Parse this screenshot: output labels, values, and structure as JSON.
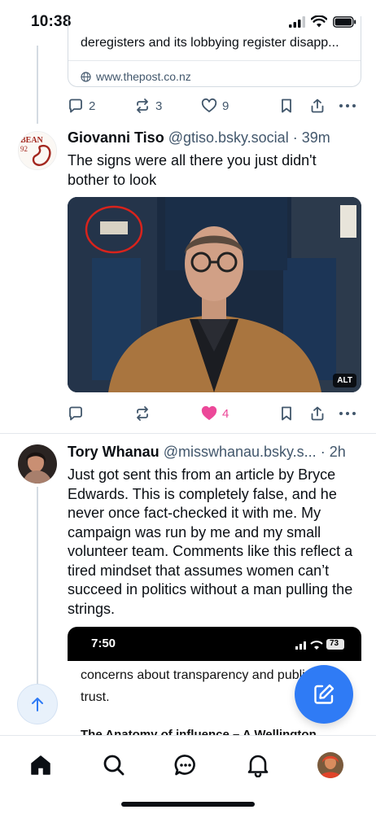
{
  "status_bar": {
    "time": "10:38"
  },
  "top_post": {
    "link_description": "deregisters and its lobbying register disapp...",
    "link_domain": "www.thepost.co.nz",
    "replies": "2",
    "reposts": "3",
    "likes": "9"
  },
  "post_giovanni": {
    "avatar_text": "BEAN 92",
    "name": "Giovanni Tiso",
    "handle": "@gtiso.bsky.social",
    "age": "39m",
    "text": "The signs were all there you just didn't bother to look",
    "image_alt_badge": "ALT",
    "likes": "4"
  },
  "post_tory": {
    "name": "Tory Whanau",
    "handle": "@misswhanau.bsky.s...",
    "age": "2h",
    "text": "Just got sent this from an article by Bryce Edwards. This is completely false, and he never once fact-checked it with me. My campaign was run by me and my small volunteer team. Comments like this reflect a tired mindset that assumes women can’t succeed in politics without a man pulling the strings.",
    "embed": {
      "time": "7:50",
      "battery": "73",
      "body": "concerns about transparency and public trust.",
      "heading": "The Anatomy of influence – A Wellington"
    }
  },
  "colors": {
    "accent": "#2f7bf5",
    "like_pink": "#ec4899",
    "muted": "#42576c"
  },
  "icons": {
    "nav": [
      "home-icon",
      "search-icon",
      "chat-icon",
      "bell-icon",
      "profile-avatar"
    ],
    "compose": "pencil-square-icon",
    "scroll_top": "arrow-up-icon"
  }
}
